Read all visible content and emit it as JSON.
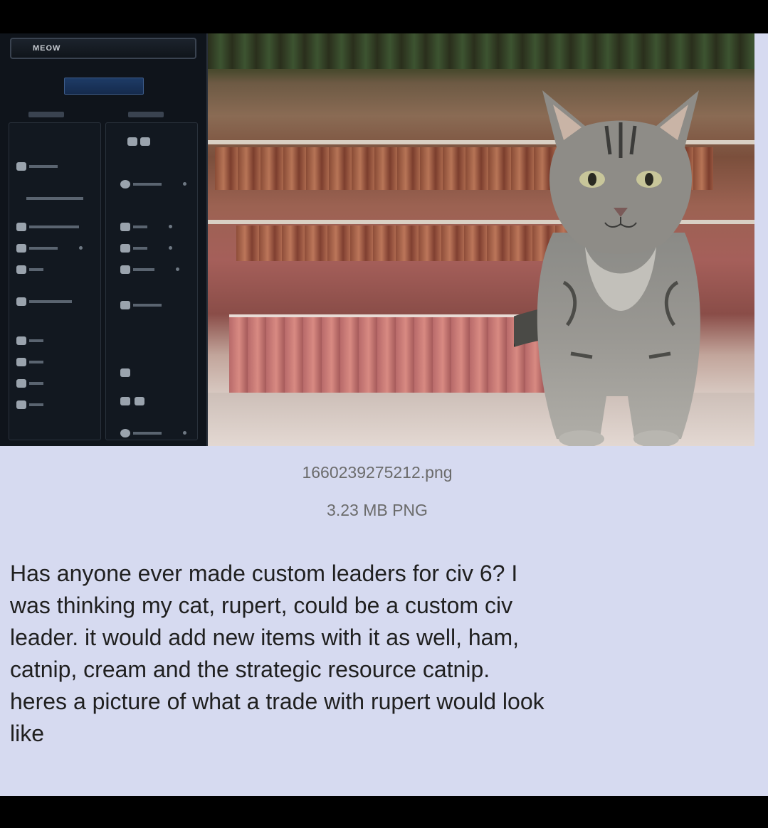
{
  "game_panel": {
    "title": "MEOW"
  },
  "file": {
    "name": "1660239275212.png",
    "size": "3.23 MB PNG"
  },
  "post": {
    "text": "Has anyone ever made custom leaders for civ 6? I\nwas thinking my cat, rupert, could be a custom civ\nleader. it would add new items with it as well, ham,\ncatnip, cream and the strategic resource catnip.\nheres a picture of what a trade with rupert would look\nlike"
  },
  "colors": {
    "post_background": "#d6daf0",
    "page_background": "#000000",
    "file_info_text": "#6b6b6b",
    "post_text": "#202020"
  }
}
